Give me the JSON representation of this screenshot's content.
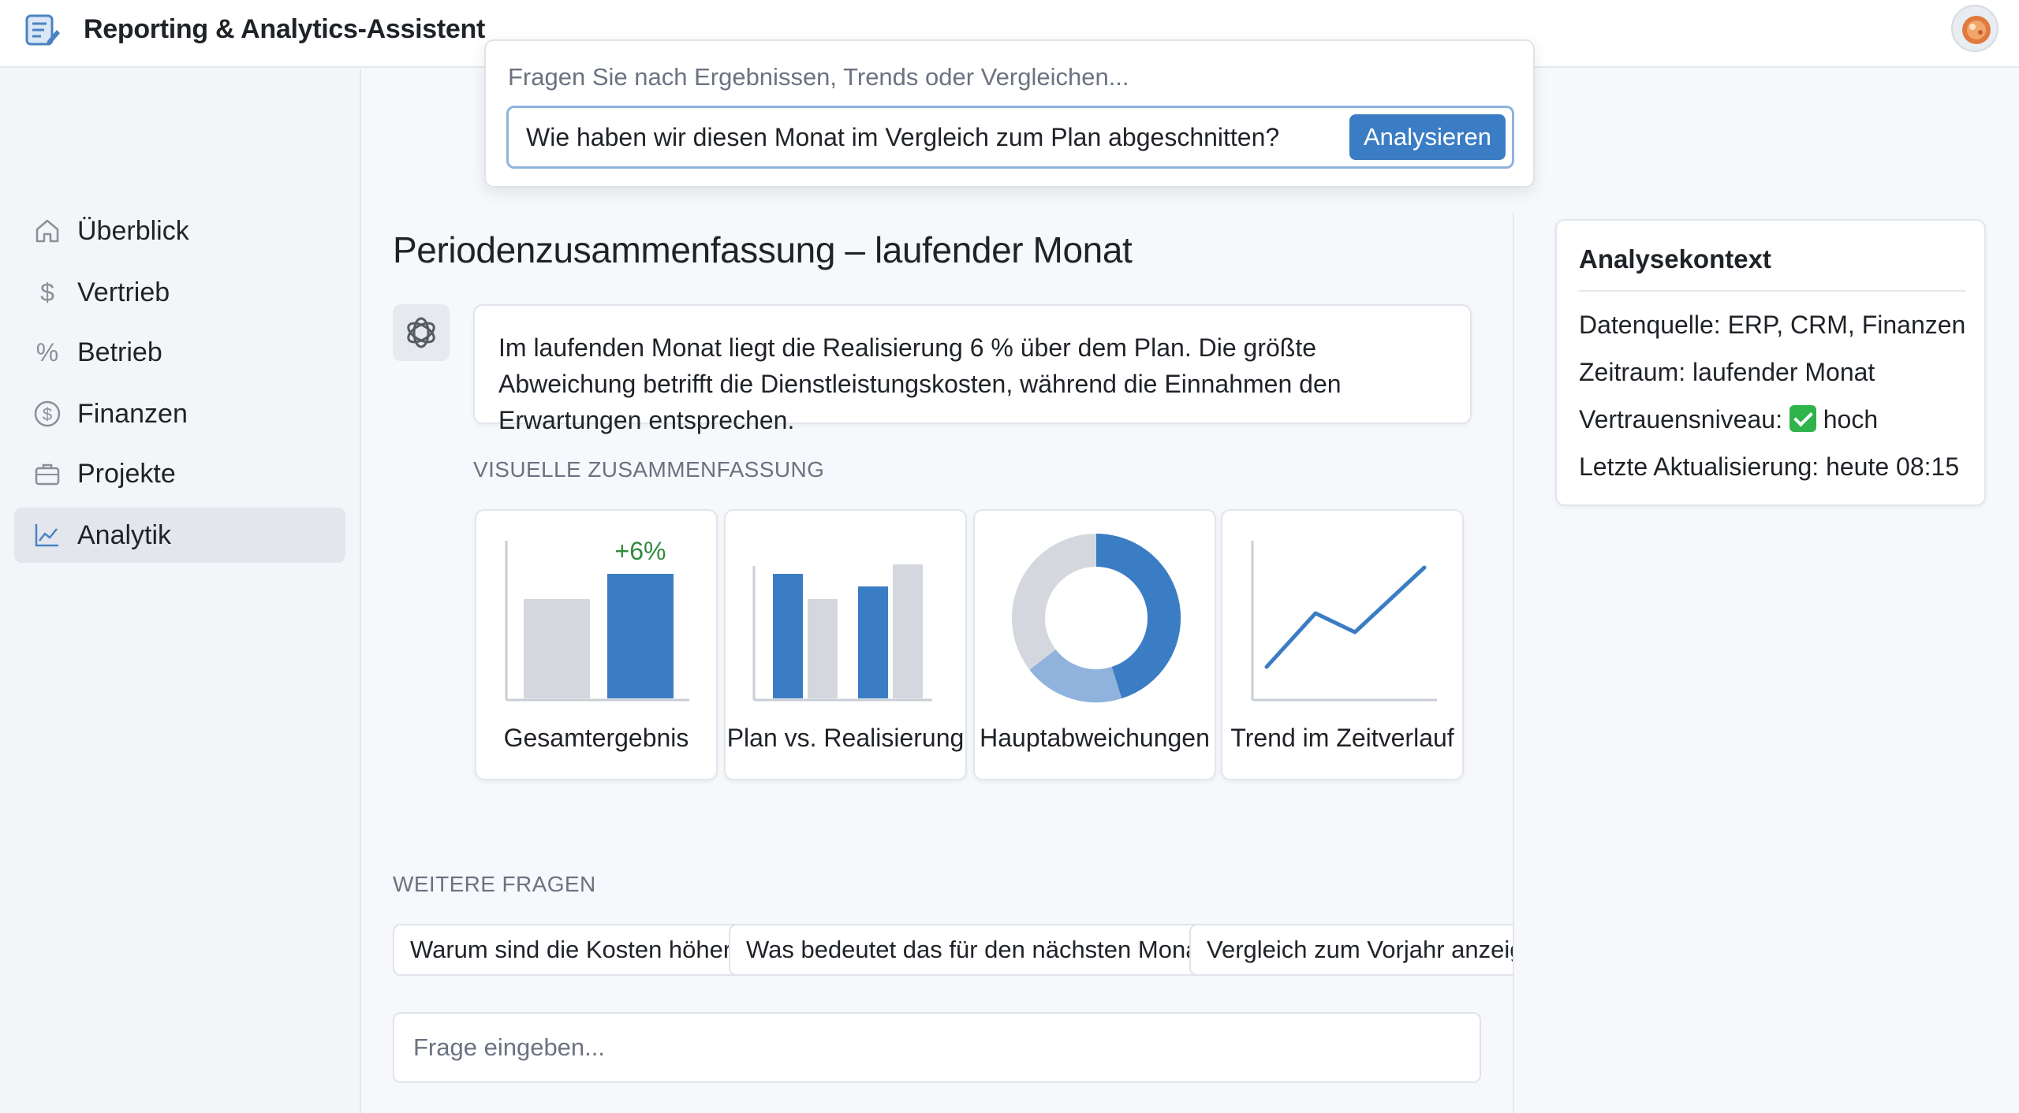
{
  "app": {
    "title": "Reporting & Analytics-Assistent"
  },
  "sidebar": {
    "items": [
      {
        "label": "Überblick",
        "icon": "home-icon"
      },
      {
        "label": "Vertrieb",
        "icon": "dollar-icon"
      },
      {
        "label": "Betrieb",
        "icon": "percent-icon"
      },
      {
        "label": "Finanzen",
        "icon": "dollar-circle-icon"
      },
      {
        "label": "Projekte",
        "icon": "briefcase-icon"
      },
      {
        "label": "Analytik",
        "icon": "chart-line-icon",
        "active": true
      }
    ]
  },
  "query": {
    "hint": "Fragen Sie nach Ergebnissen, Trends oder Vergleichen...",
    "value": "Wie haben wir diesen Monat im Vergleich zum Plan abgeschnitten?",
    "button": "Analysieren"
  },
  "summary": {
    "title": "Periodenzusammenfassung – laufender Monat",
    "text": "Im laufenden Monat liegt die Realisierung 6 % über dem Plan. Die größte Abweichung betrifft die Dienstleistungskosten, während die Einnahmen den Erwartungen entsprechen."
  },
  "visual": {
    "label": "VISUELLE ZUSAMMENFASSUNG",
    "cards": [
      {
        "label": "Gesamtergebnis",
        "badge": "+6%"
      },
      {
        "label": "Plan vs. Realisierung"
      },
      {
        "label": "Hauptabweichungen"
      },
      {
        "label": "Trend im Zeitverlauf"
      }
    ]
  },
  "more": {
    "label": "WEITERE FRAGEN",
    "chips": [
      "Warum sind die Kosten höher?",
      "Was bedeutet das für den nächsten Monat?",
      "Vergleich zum Vorjahr anzeigen"
    ]
  },
  "input": {
    "placeholder": "Frage eingeben..."
  },
  "context": {
    "title": "Analysekontext",
    "source": "Datenquelle: ERP, CRM, Finanzen",
    "period": "Zeitraum: laufender Monat",
    "confidence_label": "Vertrauensniveau:",
    "confidence_value": "hoch",
    "updated": "Letzte Aktualisierung: heute 08:15"
  },
  "colors": {
    "accent": "#3b7dc4",
    "positive": "#2e8b3e",
    "muted": "#d4d8de"
  }
}
